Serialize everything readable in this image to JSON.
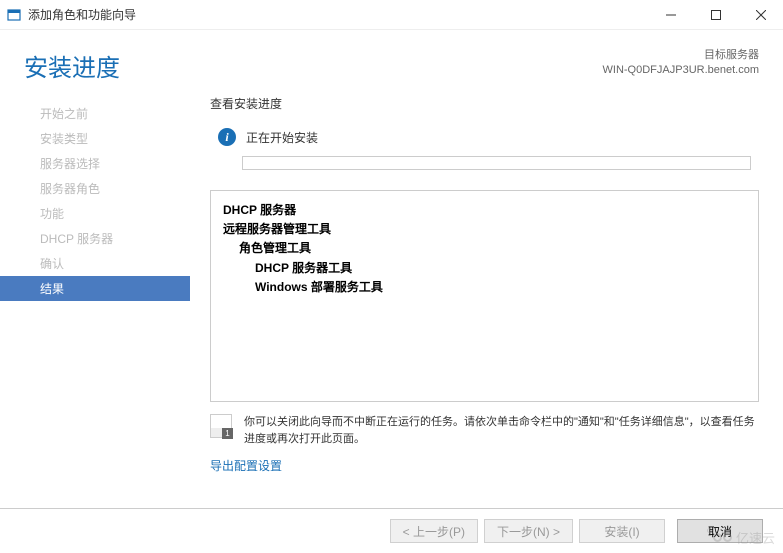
{
  "window": {
    "title": "添加角色和功能向导"
  },
  "header": {
    "title": "安装进度",
    "server_label": "目标服务器",
    "server_name": "WIN-Q0DFJAJP3UR.benet.com"
  },
  "sidebar": {
    "items": [
      {
        "label": "开始之前",
        "active": false
      },
      {
        "label": "安装类型",
        "active": false
      },
      {
        "label": "服务器选择",
        "active": false
      },
      {
        "label": "服务器角色",
        "active": false
      },
      {
        "label": "功能",
        "active": false
      },
      {
        "label": "DHCP 服务器",
        "active": false
      },
      {
        "label": "确认",
        "active": false
      },
      {
        "label": "结果",
        "active": true
      }
    ]
  },
  "content": {
    "section_label": "查看安装进度",
    "status_text": "正在开始安装",
    "results": [
      {
        "text": "DHCP 服务器",
        "indent": 0
      },
      {
        "text": "远程服务器管理工具",
        "indent": 0
      },
      {
        "text": "角色管理工具",
        "indent": 1
      },
      {
        "text": "DHCP 服务器工具",
        "indent": 2
      },
      {
        "text": "Windows 部署服务工具",
        "indent": 2
      }
    ],
    "note_text": "你可以关闭此向导而不中断正在运行的任务。请依次单击命令栏中的\"通知\"和\"任务详细信息\"，以查看任务进度或再次打开此页面。",
    "note_badge": "1",
    "export_link": "导出配置设置"
  },
  "footer": {
    "previous": "< 上一步(P)",
    "next": "下一步(N) >",
    "install": "安装(I)",
    "cancel": "取消"
  },
  "watermark": {
    "text": "亿速云"
  }
}
